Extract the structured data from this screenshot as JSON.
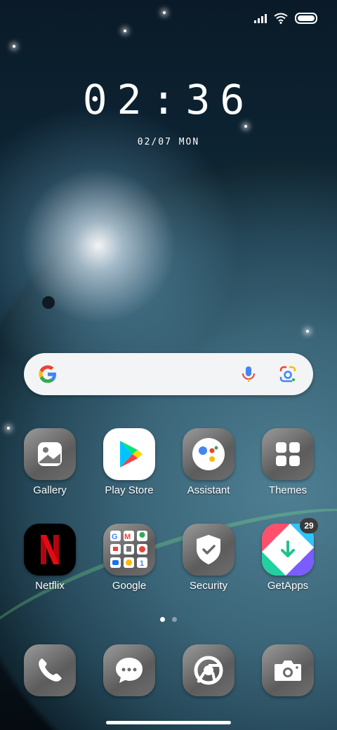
{
  "status_bar": {
    "icons": [
      "signal-icon",
      "wifi-icon",
      "battery-icon"
    ]
  },
  "clock": {
    "time": "02:36",
    "date": "02/07 MON"
  },
  "search_bar": {
    "icons": [
      "google-logo-icon",
      "mic-icon",
      "google-lens-icon"
    ]
  },
  "apps": [
    {
      "label": "Gallery",
      "icon": "gallery-icon"
    },
    {
      "label": "Play Store",
      "icon": "play-store-icon"
    },
    {
      "label": "Assistant",
      "icon": "assistant-icon"
    },
    {
      "label": "Themes",
      "icon": "themes-icon"
    },
    {
      "label": "Netflix",
      "icon": "netflix-icon"
    },
    {
      "label": "Google",
      "icon": "google-folder-icon"
    },
    {
      "label": "Security",
      "icon": "security-icon"
    },
    {
      "label": "GetApps",
      "icon": "getapps-icon",
      "badge": "29"
    }
  ],
  "page_indicator": {
    "pages": 2,
    "active": 1
  },
  "dock": [
    {
      "icon": "phone-icon"
    },
    {
      "icon": "messages-icon"
    },
    {
      "icon": "chrome-icon"
    },
    {
      "icon": "camera-icon"
    }
  ],
  "colors": {
    "search_bg": "#f2f4f6",
    "netflix_red": "#e50914",
    "google_blue": "#4285f4",
    "google_red": "#ea4335",
    "google_yellow": "#fbbc05",
    "google_green": "#34a853"
  }
}
